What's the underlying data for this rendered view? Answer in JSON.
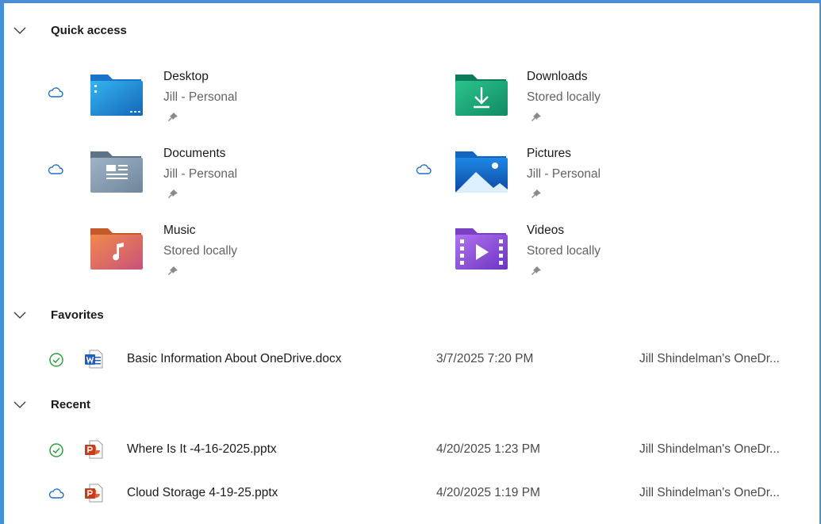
{
  "sections": {
    "quick_access": "Quick access",
    "favorites": "Favorites",
    "recent": "Recent"
  },
  "quick_access": [
    {
      "name": "Desktop",
      "subtitle": "Jill - Personal",
      "cloud": true,
      "icon": "desktop-folder-icon"
    },
    {
      "name": "Downloads",
      "subtitle": "Stored locally",
      "cloud": false,
      "icon": "downloads-folder-icon"
    },
    {
      "name": "Documents",
      "subtitle": "Jill - Personal",
      "cloud": true,
      "icon": "documents-folder-icon"
    },
    {
      "name": "Pictures",
      "subtitle": "Jill - Personal",
      "cloud": true,
      "icon": "pictures-folder-icon"
    },
    {
      "name": "Music",
      "subtitle": "Stored locally",
      "cloud": false,
      "icon": "music-folder-icon"
    },
    {
      "name": "Videos",
      "subtitle": "Stored locally",
      "cloud": false,
      "icon": "videos-folder-icon"
    }
  ],
  "favorites": [
    {
      "name": "Basic Information About OneDrive.docx",
      "date": "3/7/2025 7:20 PM",
      "location": "Jill Shindelman's OneDr...",
      "status": "synced-check-icon",
      "type": "word-file-icon"
    }
  ],
  "recent": [
    {
      "name": "Where Is It -4-16-2025.pptx",
      "date": "4/20/2025 1:23 PM",
      "location": "Jill Shindelman's OneDr...",
      "status": "synced-check-icon",
      "type": "powerpoint-file-icon"
    },
    {
      "name": "Cloud Storage 4-19-25.pptx",
      "date": "4/20/2025 1:19 PM",
      "location": "Jill Shindelman's OneDr...",
      "status": "cloud-icon",
      "type": "powerpoint-file-icon"
    }
  ],
  "colors": {
    "frame_border": "#4a8fd6",
    "cloud_status": "#1f6fc4",
    "synced_status": "#2e9e3e"
  }
}
